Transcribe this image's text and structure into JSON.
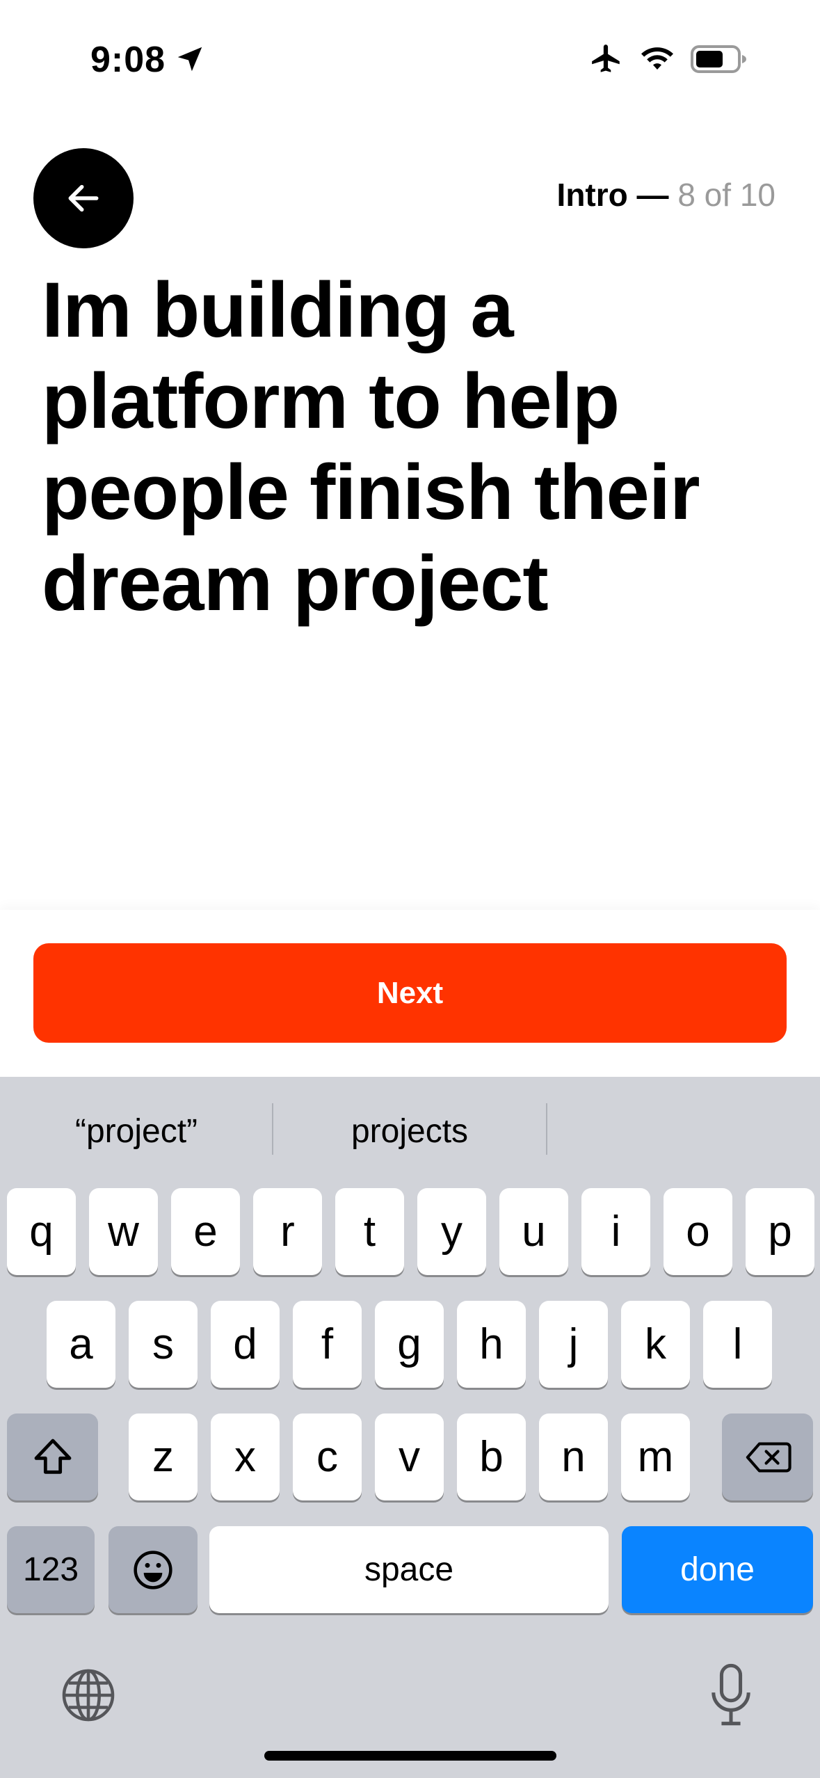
{
  "status_bar": {
    "time": "9:08",
    "icons": [
      "location-arrow-icon",
      "airplane-icon",
      "wifi-icon",
      "battery-icon"
    ]
  },
  "header": {
    "back_icon": "arrow-left-icon",
    "progress_section": "Intro",
    "progress_dash": " — ",
    "progress_count": "8 of 10"
  },
  "content": {
    "text": "Im building a platform to help people finish their dream project"
  },
  "next_button": {
    "label": "Next",
    "color": "#ff3300"
  },
  "keyboard": {
    "suggestions": [
      "“project”",
      "projects"
    ],
    "row1": [
      "q",
      "w",
      "e",
      "r",
      "t",
      "y",
      "u",
      "i",
      "o",
      "p"
    ],
    "row2": [
      "a",
      "s",
      "d",
      "f",
      "g",
      "h",
      "j",
      "k",
      "l"
    ],
    "row3": [
      "z",
      "x",
      "c",
      "v",
      "b",
      "n",
      "m"
    ],
    "numbers_label": "123",
    "space_label": "space",
    "done_label": "done",
    "done_color": "#0a84ff"
  }
}
